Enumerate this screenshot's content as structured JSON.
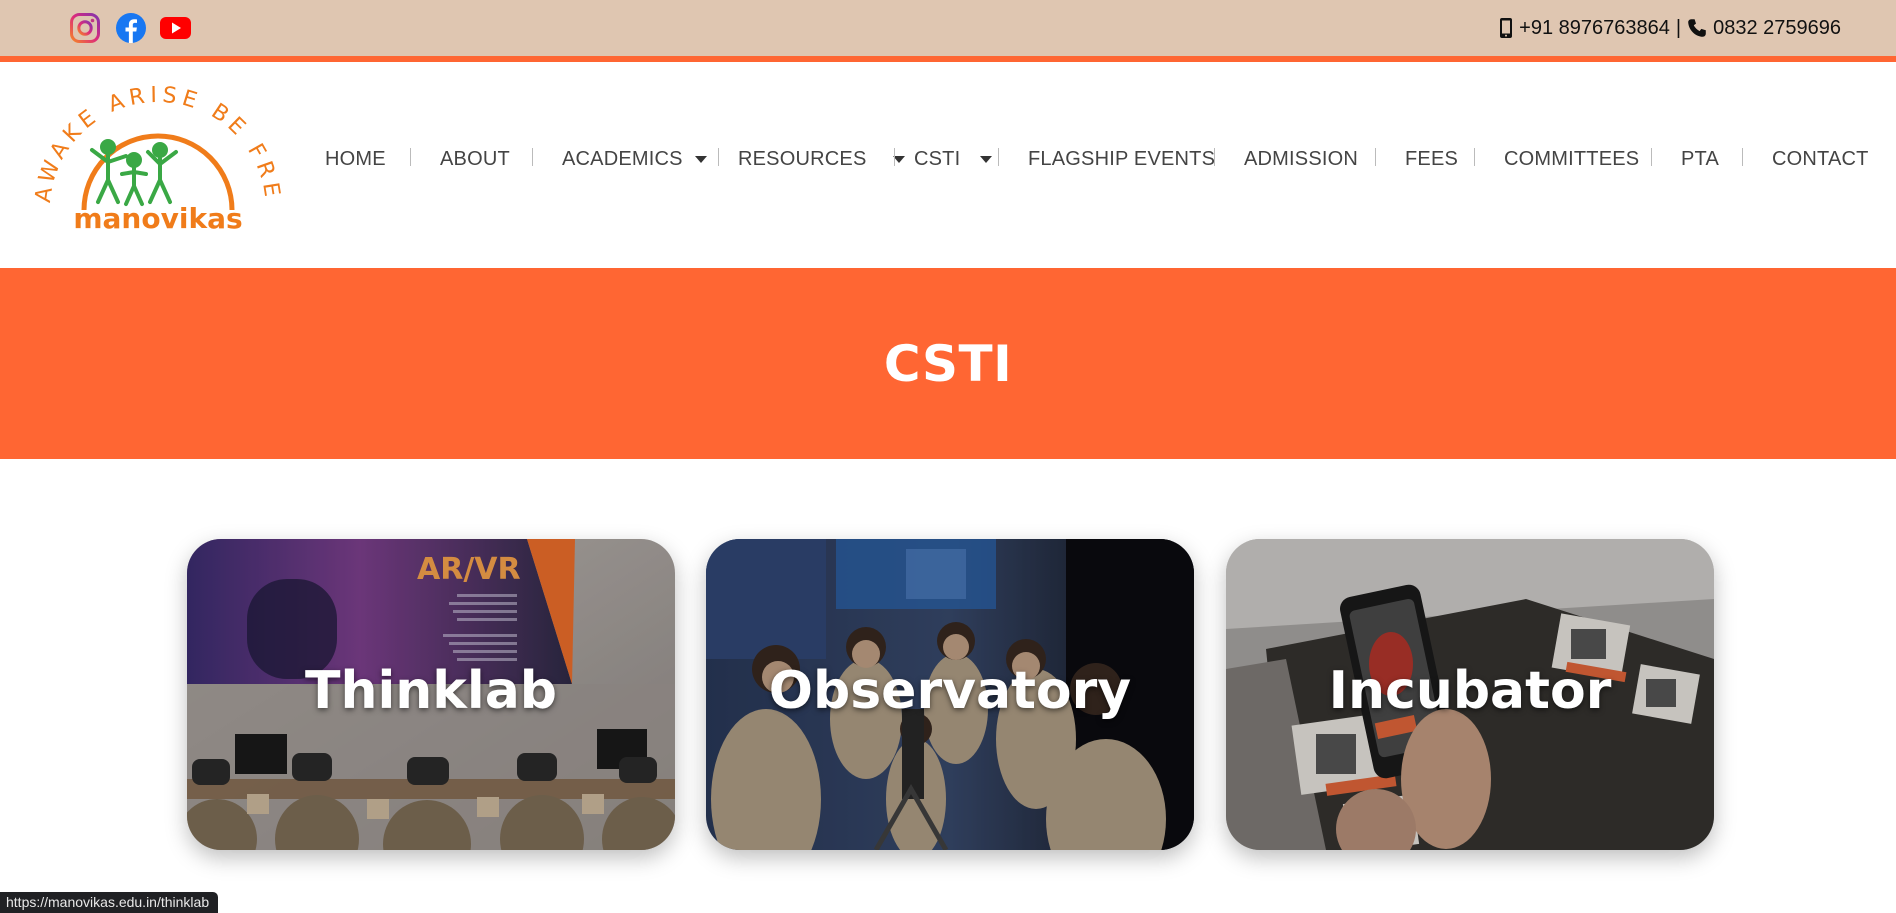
{
  "topbar": {
    "social": [
      "instagram-icon",
      "facebook-icon",
      "youtube-icon"
    ],
    "mobile": "+91 8976763864",
    "separator": "|",
    "phone": "0832 2759696"
  },
  "logo": {
    "tagline": "AWAKE ARISE BE FREE",
    "name": "manovikas"
  },
  "nav": {
    "items": [
      {
        "label": "HOME"
      },
      {
        "label": "ABOUT"
      },
      {
        "label": "ACADEMICS"
      },
      {
        "label": "RESOURCES"
      },
      {
        "label": "CSTI"
      },
      {
        "label": "FLAGSHIP EVENTS"
      },
      {
        "label": "ADMISSION"
      },
      {
        "label": "FEES"
      },
      {
        "label": "COMMITTEES"
      },
      {
        "label": "PTA"
      },
      {
        "label": "CONTACT"
      }
    ]
  },
  "banner": {
    "title": "CSTI"
  },
  "cards": [
    {
      "label": "Thinklab",
      "poster_title": "AR/VR"
    },
    {
      "label": "Observatory"
    },
    {
      "label": "Incubator"
    }
  ],
  "status": {
    "url": "https://manovikas.edu.in/thinklab"
  },
  "colors": {
    "topbar": "#dfc6b1",
    "accent": "#ff6633",
    "logo_orange": "#f07c1a",
    "logo_green": "#3aa845"
  }
}
